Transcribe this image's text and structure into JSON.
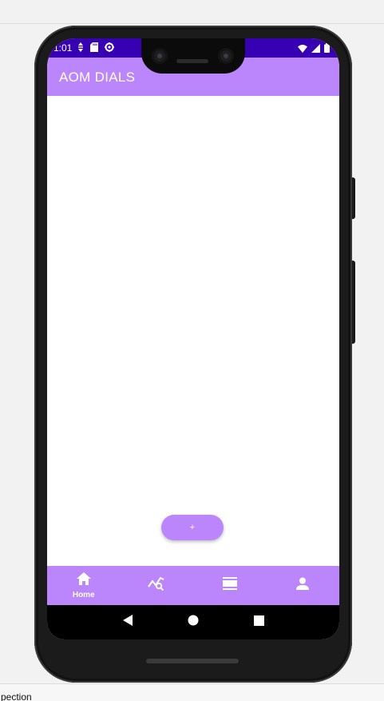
{
  "status_bar": {
    "time": "1:01",
    "left_icons": [
      "data-icon",
      "sd-card-icon",
      "settings-icon"
    ],
    "right_icons": [
      "wifi-icon",
      "signal-icon",
      "battery-icon"
    ],
    "color": "#3700b3"
  },
  "app_bar": {
    "title": "AOM DIALS",
    "color": "#bb86fc"
  },
  "fab": {
    "label": "+"
  },
  "bottom_nav": {
    "items": [
      {
        "label": "Home",
        "icon": "home-icon",
        "active": true
      },
      {
        "label": "",
        "icon": "chart-search-icon",
        "active": false
      },
      {
        "label": "",
        "icon": "list-view-icon",
        "active": false
      },
      {
        "label": "",
        "icon": "person-icon",
        "active": false
      }
    ]
  },
  "system_nav": {
    "icons": [
      "back-icon",
      "home-circle-icon",
      "recents-icon"
    ]
  },
  "window": {
    "bottom_text": "pection"
  }
}
